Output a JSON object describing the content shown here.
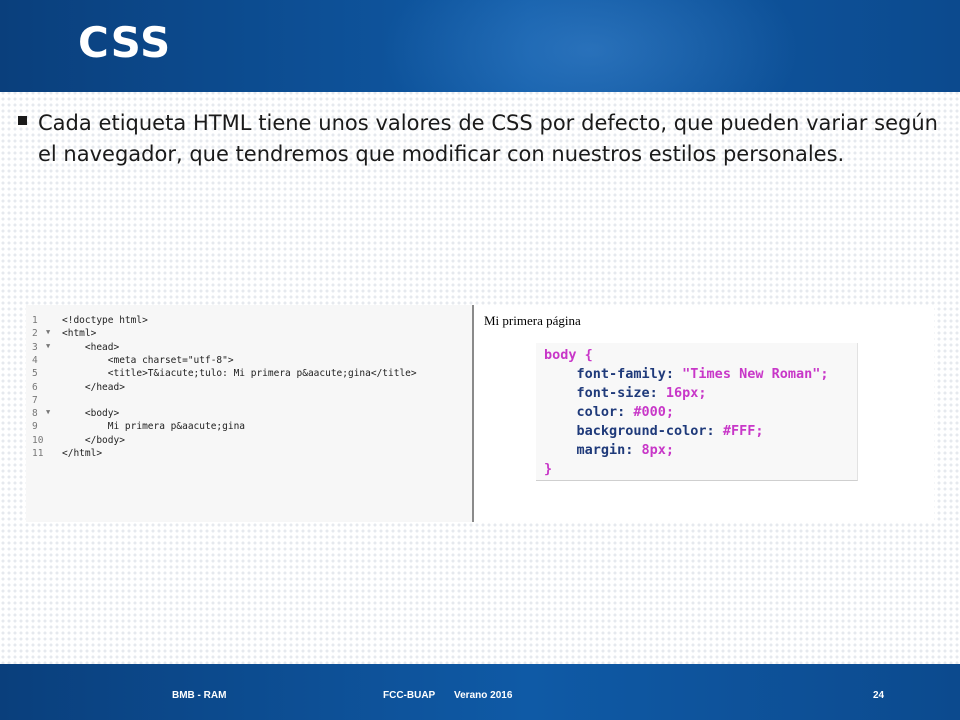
{
  "header": {
    "title": "CSS"
  },
  "bullet": {
    "text": "Cada etiqueta HTML tiene unos valores de CSS por defecto, que pueden variar según el navegador, que tendremos que modificar con nuestros estilos personales."
  },
  "code_editor": {
    "lines": [
      {
        "n": "1",
        "fold": "",
        "text": "<!doctype html>"
      },
      {
        "n": "2",
        "fold": "▼",
        "text": "<html>"
      },
      {
        "n": "3",
        "fold": "▼",
        "text": "    <head>"
      },
      {
        "n": "4",
        "fold": "",
        "text": "        <meta charset=\"utf-8\">"
      },
      {
        "n": "5",
        "fold": "",
        "text": "        <title>T&iacute;tulo: Mi primera p&aacute;gina</title>"
      },
      {
        "n": "6",
        "fold": "",
        "text": "    </head>"
      },
      {
        "n": "7",
        "fold": "",
        "text": ""
      },
      {
        "n": "8",
        "fold": "▼",
        "text": "    <body>"
      },
      {
        "n": "9",
        "fold": "",
        "text": "        Mi primera p&aacute;gina"
      },
      {
        "n": "10",
        "fold": "",
        "text": "    </body>"
      },
      {
        "n": "11",
        "fold": "",
        "text": "</html>"
      }
    ]
  },
  "browser": {
    "page_text": "Mi primera página",
    "css_lines": [
      "body {",
      "    font-family: \"Times New Roman\";",
      "    font-size: 16px;",
      "    color: #000;",
      "    background-color: #FFF;",
      "    margin: 8px;",
      "}"
    ]
  },
  "footer": {
    "left": "BMB - RAM",
    "center": "FCC-BUAP",
    "center2": "Verano 2016",
    "page": "24"
  },
  "colors": {
    "header_blue": "#0f5aa6",
    "css_selector": "#c837c8",
    "css_property": "#1f3a7a",
    "css_value": "#c837c8"
  }
}
